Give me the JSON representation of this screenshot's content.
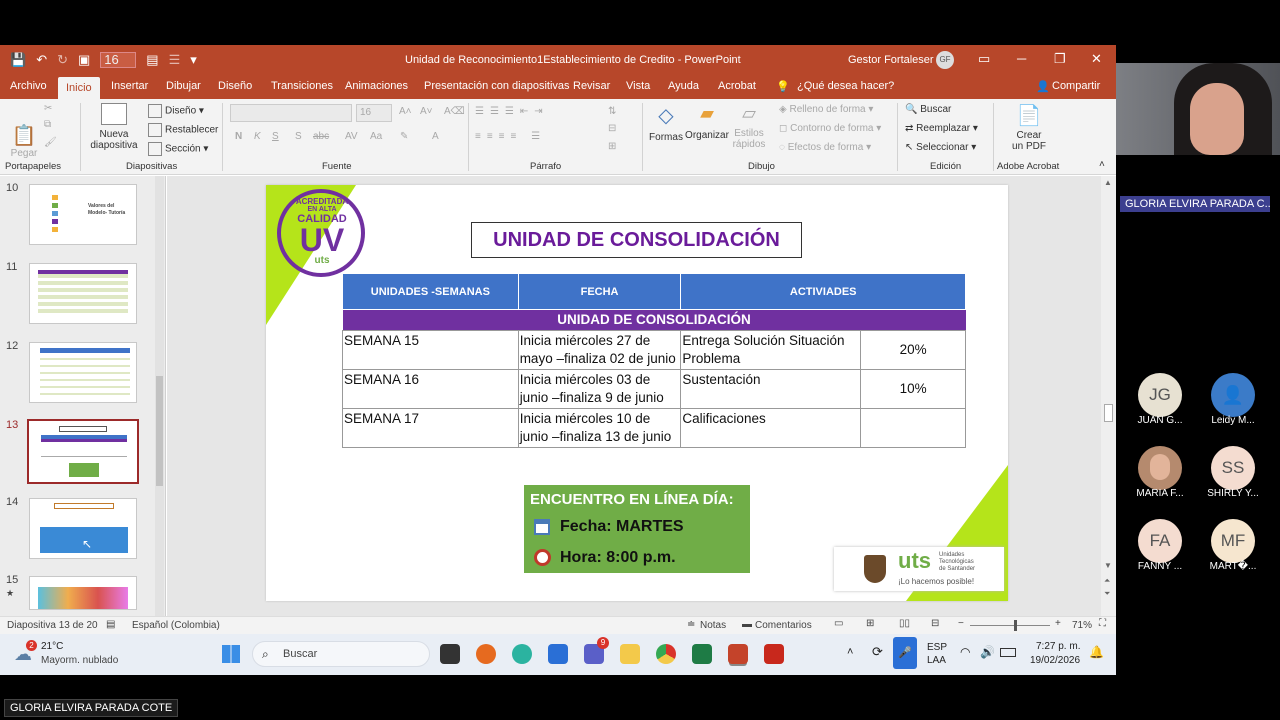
{
  "window": {
    "doc_title": "Unidad de Reconocimiento1Establecimiento de Credito  -  PowerPoint",
    "account_name": "Gestor Fortaleser 7",
    "account_initials": "GF",
    "font_size_value": "16"
  },
  "tabs": [
    "Archivo",
    "Inicio",
    "Insertar",
    "Dibujar",
    "Diseño",
    "Transiciones",
    "Animaciones",
    "Presentación con diapositivas",
    "Revisar",
    "Vista",
    "Ayuda",
    "Acrobat",
    "¿Qué desea hacer?",
    "Compartir"
  ],
  "ribbon": {
    "portapapeles": {
      "pegar": "Pegar",
      "label": "Portapapeles"
    },
    "diapositivas": {
      "nueva": "Nueva",
      "diapositiva": "diapositiva",
      "diseno": "Diseño",
      "restablecer": "Restablecer",
      "seccion": "Sección",
      "label": "Diapositivas"
    },
    "fuente": {
      "size": "16",
      "bold": "N",
      "italic": "K",
      "underline": "S",
      "strike": "S",
      "shadow": "abc",
      "label": "Fuente"
    },
    "parrafo": {
      "label": "Párrafo"
    },
    "dibujo": {
      "formas": "Formas",
      "organizar": "Organizar",
      "estilos": "Estilos",
      "rapidos": "rápidos",
      "relleno": "Relleno de forma",
      "contorno": "Contorno de forma",
      "efectos": "Efectos de forma",
      "label": "Dibujo"
    },
    "edicion": {
      "buscar": "Buscar",
      "reemplazar": "Reemplazar",
      "seleccionar": "Seleccionar",
      "label": "Edición"
    },
    "acrobat": {
      "crear": "Crear",
      "pdf": "un PDF",
      "label": "Adobe Acrobat"
    }
  },
  "thumbs": {
    "numbers": [
      "10",
      "11",
      "12",
      "13",
      "14",
      "15"
    ],
    "t10_line1": "Valores del",
    "t10_line2": "Modelo- Tutoría"
  },
  "slide": {
    "title": "UNIDAD DE CONSOLIDACIÓN",
    "logo": {
      "line1": "ACREDITADA",
      "line2": "EN ALTA",
      "line3": "CALIDAD",
      "mark": "UV",
      "sub": "uts"
    },
    "headers": [
      "UNIDADES -SEMANAS",
      "FECHA",
      "ACTIVIADES"
    ],
    "band": "UNIDAD DE CONSOLIDACIÓN",
    "rows": [
      {
        "semana": "SEMANA 15",
        "fecha": "Inicia miércoles 27 de mayo –finaliza 02 de junio",
        "actividad": "Entrega Solución Situación Problema",
        "pct": "20%"
      },
      {
        "semana": "SEMANA 16",
        "fecha": "Inicia miércoles 03 de junio –finaliza 9 de junio",
        "actividad": "Sustentación",
        "pct": "10%"
      },
      {
        "semana": "SEMANA 17",
        "fecha": "Inicia miércoles 10 de junio –finaliza 13 de junio",
        "actividad": "Calificaciones",
        "pct": ""
      }
    ],
    "meeting": {
      "line1": "ENCUENTRO EN LÍNEA DÍA:",
      "fecha": "Fecha: MARTES",
      "hora": "Hora: 8:00 p.m."
    },
    "uts_logo": {
      "name": "uts",
      "line1": "Unidades",
      "line2": "Tecnológicas",
      "line3": "de Santander",
      "slogan": "¡Lo hacemos posible!"
    }
  },
  "status": {
    "slide_info": "Diapositiva 13 de 20",
    "language": "Español (Colombia)",
    "notas": "Notas",
    "comentarios": "Comentarios",
    "zoom": "71%",
    "zoom_fraction": 0.55
  },
  "taskbar": {
    "temp": "21°C",
    "weather": "Mayorm. nublado",
    "weather_badge": "2",
    "search": "Buscar",
    "lang1": "ESP",
    "lang2": "LAA",
    "time": "7:27 p. m.",
    "date": "19/02/2026",
    "badge": "9"
  },
  "meeting_side": {
    "top_name": "GLORIA ELVIRA PARADA C...",
    "bottom_name": "GLORIA ELVIRA PARADA COTE",
    "participants": [
      {
        "initials": "JG",
        "label": "JUAN G..."
      },
      {
        "initials": "",
        "label": "Leidy M..."
      },
      {
        "initials": "",
        "label": "MARIA F..."
      },
      {
        "initials": "SS",
        "label": "SHIRLY Y..."
      },
      {
        "initials": "FA",
        "label": "FANNY ..."
      },
      {
        "initials": "MF",
        "label": "MART�..."
      }
    ]
  },
  "colors": {
    "ppt_red": "#b7472a",
    "slide_purple": "#7030a0",
    "table_blue": "#3f73c8",
    "green": "#70ad47",
    "lime": "#a8d60a"
  }
}
